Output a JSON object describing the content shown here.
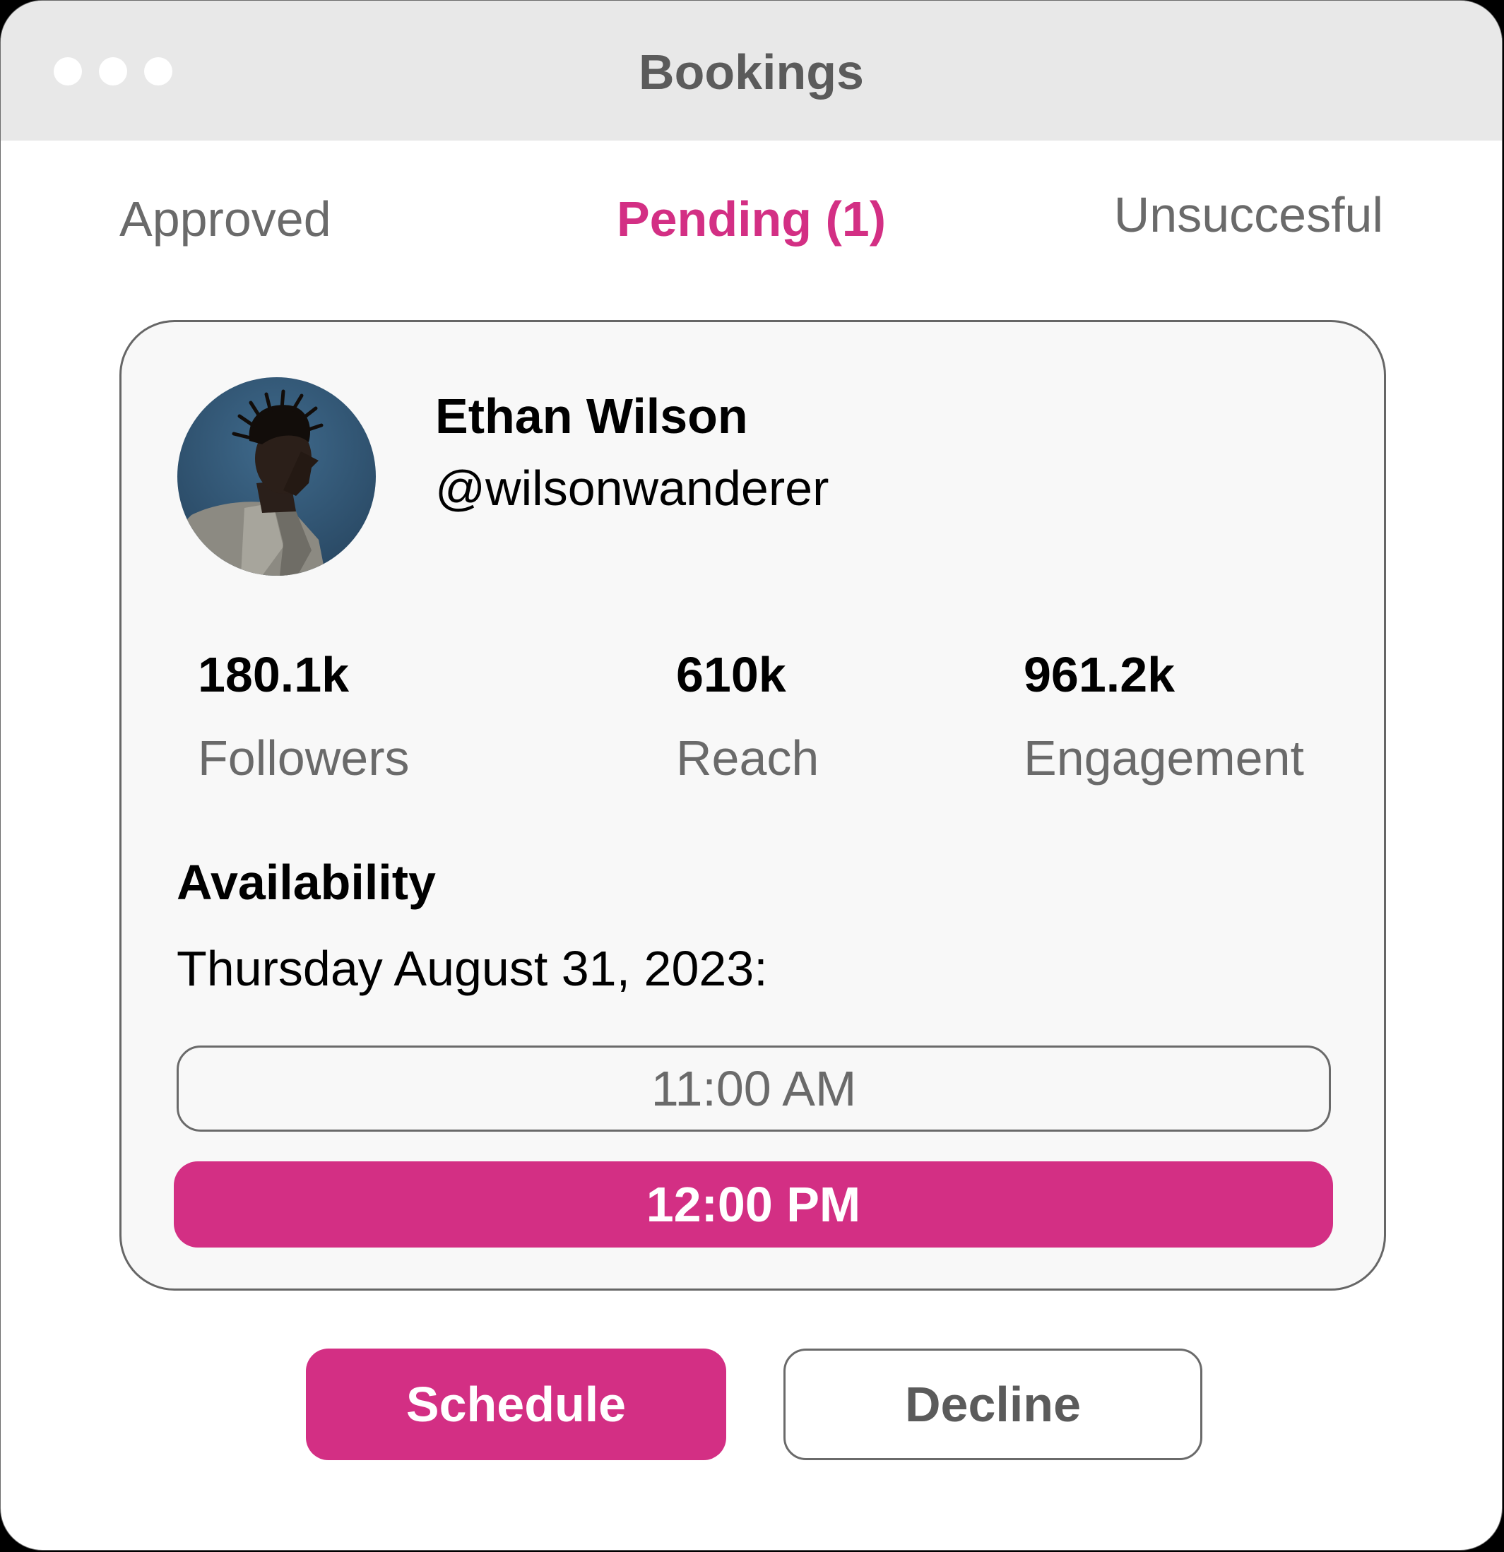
{
  "window": {
    "title": "Bookings"
  },
  "tabs": [
    {
      "label": "Approved",
      "active": false
    },
    {
      "label": "Pending (1)",
      "active": true
    },
    {
      "label": "Unsuccesful",
      "active": false
    }
  ],
  "profile": {
    "name": "Ethan Wilson",
    "handle": "@wilsonwanderer",
    "avatar_icon": "profile-photo"
  },
  "stats": [
    {
      "value": "180.1k",
      "label": "Followers"
    },
    {
      "value": "610k",
      "label": "Reach"
    },
    {
      "value": "961.2k",
      "label": "Engagement"
    }
  ],
  "availability": {
    "title": "Availability",
    "date": "Thursday August 31, 2023:",
    "slots": [
      {
        "time": "11:00 AM",
        "selected": false
      },
      {
        "time": "12:00 PM",
        "selected": true
      }
    ]
  },
  "actions": {
    "schedule_label": "Schedule",
    "decline_label": "Decline"
  },
  "colors": {
    "accent": "#d32f84",
    "titlebar": "#e8e8e8",
    "card_bg": "#f8f8f8",
    "muted_text": "#6a6a6a"
  }
}
